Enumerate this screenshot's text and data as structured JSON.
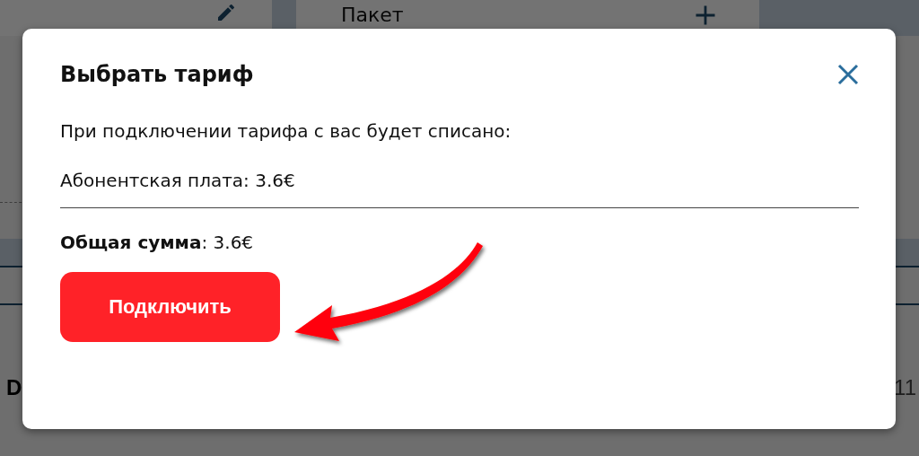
{
  "background": {
    "tab_label": "Пакет",
    "row_start": "D",
    "row_end": "11"
  },
  "dialog": {
    "title": "Выбрать тариф",
    "message": "При подключении тарифа с вас будет списано:",
    "fee": "Абонентская плата: 3.6€",
    "total": "**Общая сумма**: 3.6€",
    "button": "Подключить"
  }
}
